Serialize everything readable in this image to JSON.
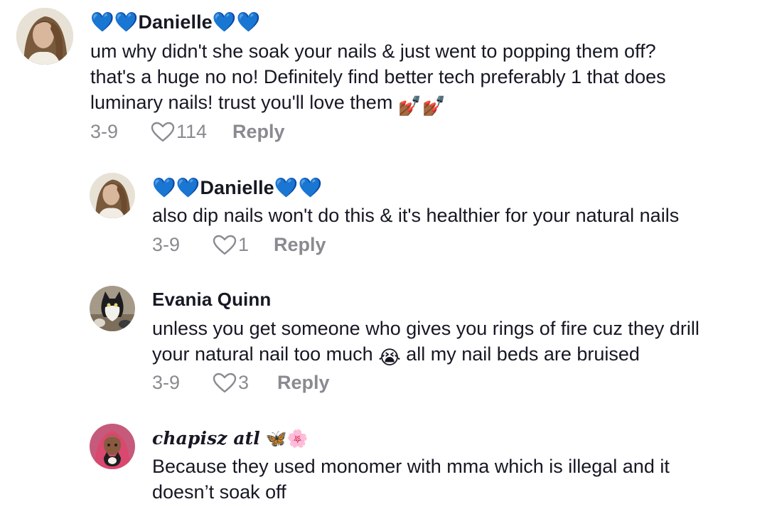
{
  "comments": [
    {
      "username": "Danielle",
      "username_prefix_emoji": "💙💙",
      "username_suffix_emoji": "💙💙",
      "text_lines": [
        "um why didn't she soak your nails & just went to popping them off?",
        "that's a huge no no! Definitely find better tech preferably 1 that does",
        "luminary nails! trust you'll love them"
      ],
      "trailing_emoji": "💅🏾💅🏾",
      "date": "3-9",
      "likes": "114",
      "reply_label": "Reply"
    },
    {
      "username": "Danielle",
      "username_prefix_emoji": "💙💙",
      "username_suffix_emoji": "💙💙",
      "text_lines": [
        "also dip nails won't do this & it's healthier for your natural nails"
      ],
      "date": "3-9",
      "likes": "1",
      "reply_label": "Reply"
    },
    {
      "username": "Evania Quinn",
      "text_lines": [
        "unless you get someone who gives you rings of fire cuz they drill",
        "your natural nail too much",
        "all my nail beds are bruised"
      ],
      "inline_emoji": "😭",
      "date": "3-9",
      "likes": "3",
      "reply_label": "Reply"
    },
    {
      "username": "chapisz atl",
      "username_suffix_emoji": "🦋🌸",
      "text_lines": [
        "Because they used monomer with mma which is illegal and it",
        "doesn’t soak off"
      ]
    }
  ],
  "icons": {
    "like": "heart-outline-icon"
  },
  "colors": {
    "text": "#161823",
    "meta": "#8a8b91",
    "heart_blue": "#2f6fe8"
  }
}
